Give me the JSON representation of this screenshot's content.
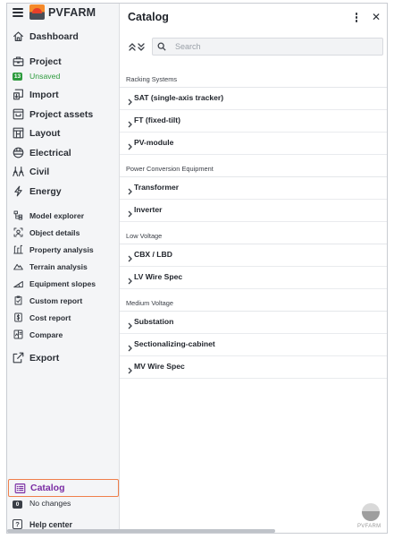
{
  "app": {
    "brand": "PVFARM"
  },
  "sidebar": {
    "items": [
      {
        "key": "dashboard",
        "label": "Dashboard"
      },
      {
        "key": "project",
        "label": "Project"
      },
      {
        "key": "import",
        "label": "Import"
      },
      {
        "key": "project_assets",
        "label": "Project assets"
      },
      {
        "key": "layout",
        "label": "Layout"
      },
      {
        "key": "electrical",
        "label": "Electrical"
      },
      {
        "key": "civil",
        "label": "Civil"
      },
      {
        "key": "energy",
        "label": "Energy"
      },
      {
        "key": "model_explorer",
        "label": "Model explorer"
      },
      {
        "key": "object_details",
        "label": "Object details"
      },
      {
        "key": "property_analysis",
        "label": "Property analysis"
      },
      {
        "key": "terrain_analysis",
        "label": "Terrain analysis"
      },
      {
        "key": "equipment_slopes",
        "label": "Equipment slopes"
      },
      {
        "key": "custom_report",
        "label": "Custom report"
      },
      {
        "key": "cost_report",
        "label": "Cost report"
      },
      {
        "key": "compare",
        "label": "Compare"
      },
      {
        "key": "export",
        "label": "Export"
      },
      {
        "key": "catalog",
        "label": "Catalog"
      },
      {
        "key": "help_center",
        "label": "Help center"
      }
    ],
    "project_status": {
      "badge": "13",
      "text": "Unsaved",
      "color": "#2e9b3e"
    },
    "catalog_status": {
      "badge": "0",
      "text": "No changes"
    }
  },
  "panel": {
    "title": "Catalog",
    "search_placeholder": "Search",
    "groups": [
      {
        "title": "Racking Systems",
        "rows": [
          "SAT (single-axis tracker)",
          "FT (fixed-tilt)",
          "PV-module"
        ]
      },
      {
        "title": "Power Conversion Equipment",
        "rows": [
          "Transformer",
          "Inverter"
        ]
      },
      {
        "title": "Low Voltage",
        "rows": [
          "CBX / LBD",
          "LV Wire Spec"
        ]
      },
      {
        "title": "Medium Voltage",
        "rows": [
          "Substation",
          "Sectionalizing-cabinet",
          "MV Wire Spec"
        ]
      }
    ]
  },
  "watermark": {
    "text": "PVFARM"
  },
  "colors": {
    "accent": "#7a2ca3",
    "highlight_border": "#ef7f4b",
    "success": "#2e9b3e"
  }
}
